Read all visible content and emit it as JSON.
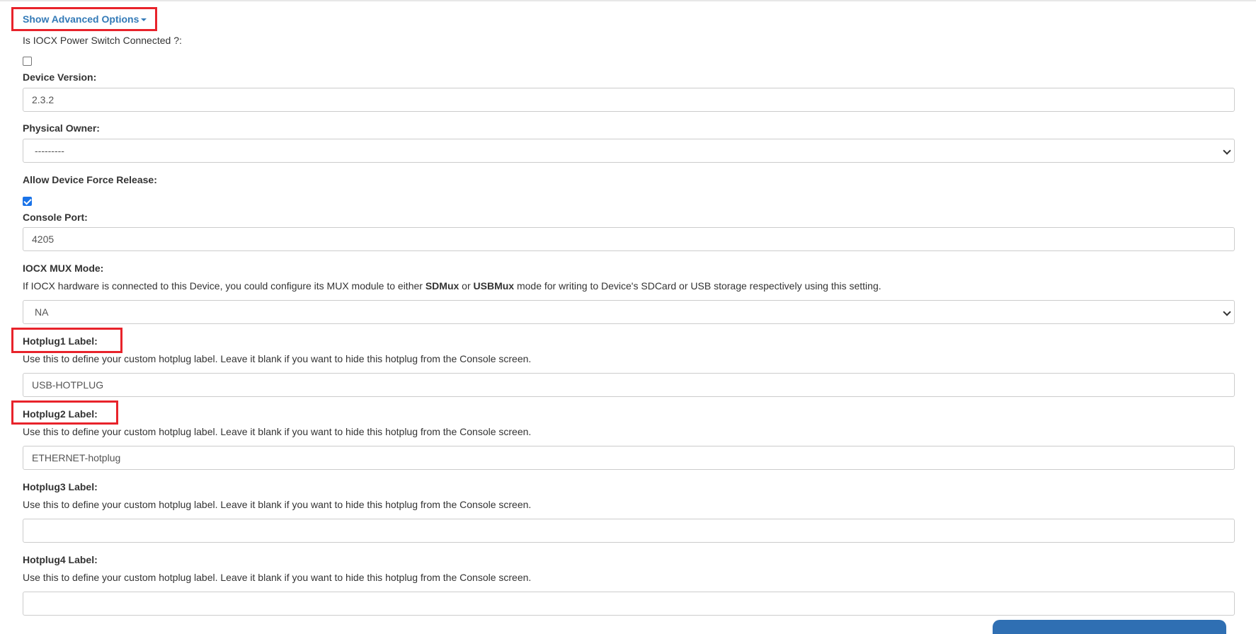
{
  "advanced_toggle": {
    "label": "Show Advanced Options"
  },
  "iocx_power": {
    "label": "Is IOCX Power Switch Connected ?:",
    "checked": false
  },
  "device_version": {
    "label": "Device Version:",
    "value": "2.3.2"
  },
  "physical_owner": {
    "label": "Physical Owner:",
    "selected": "---------"
  },
  "force_release": {
    "label": "Allow Device Force Release:",
    "checked": true
  },
  "console_port": {
    "label": "Console Port:",
    "value": "4205"
  },
  "mux_mode": {
    "label": "IOCX MUX Mode:",
    "help_prefix": "If IOCX hardware is connected to this Device, you could configure its MUX module to either ",
    "help_sdmux": "SDMux",
    "help_or": " or ",
    "help_usbmux": "USBMux",
    "help_suffix": " mode for writing to Device's SDCard or USB storage respectively using this setting.",
    "selected": "NA"
  },
  "hotplugs": [
    {
      "label": "Hotplug1 Label:",
      "help": "Use this to define your custom hotplug label. Leave it blank if you want to hide this hotplug from the Console screen.",
      "value": "USB-HOTPLUG"
    },
    {
      "label": "Hotplug2 Label:",
      "help": "Use this to define your custom hotplug label. Leave it blank if you want to hide this hotplug from the Console screen.",
      "value": "ETHERNET-hotplug"
    },
    {
      "label": "Hotplug3 Label:",
      "help": "Use this to define your custom hotplug label. Leave it blank if you want to hide this hotplug from the Console screen.",
      "value": ""
    },
    {
      "label": "Hotplug4 Label:",
      "help": "Use this to define your custom hotplug label. Leave it blank if you want to hide this hotplug from the Console screen.",
      "value": ""
    }
  ],
  "colors": {
    "link": "#337ab7",
    "highlight": "#e8232b",
    "checkbox_checked": "#1a73e8"
  }
}
